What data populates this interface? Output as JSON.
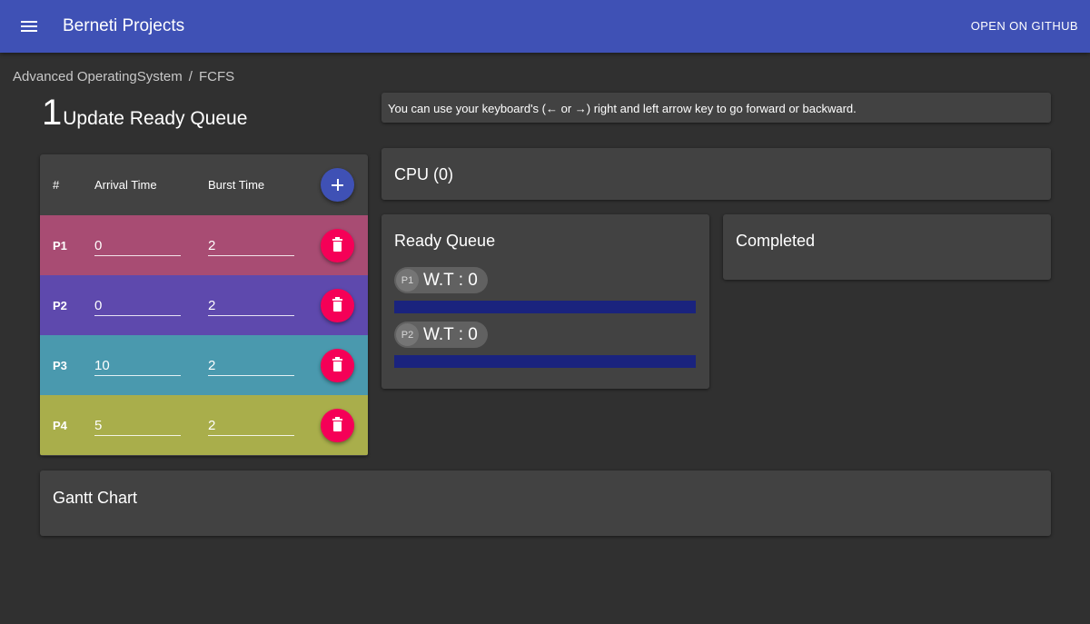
{
  "appbar": {
    "title": "Berneti Projects",
    "github_label": "OPEN ON GITHUB",
    "icons": {
      "menu": "menu-icon"
    },
    "color": "#3f51b5"
  },
  "breadcrumb": {
    "items": [
      "Advanced OperatingSystem",
      "FCFS"
    ],
    "separator": "/"
  },
  "step": {
    "number": "1",
    "title": "Update Ready Queue"
  },
  "hint": "You can use your keyboard's (← or →) right and left arrow key to go forward or backward.",
  "process_table": {
    "headers": {
      "id": "#",
      "arrival": "Arrival Time",
      "burst": "Burst Time"
    },
    "add_icon": "plus-icon",
    "delete_icon": "trash-icon",
    "rows": [
      {
        "name": "P1",
        "arrival": "0",
        "burst": "2",
        "color": "#a84c73"
      },
      {
        "name": "P2",
        "arrival": "0",
        "burst": "2",
        "color": "#5e49ad"
      },
      {
        "name": "P3",
        "arrival": "10",
        "burst": "2",
        "color": "#4a99ae"
      },
      {
        "name": "P4",
        "arrival": "5",
        "burst": "2",
        "color": "#a9ae4b"
      }
    ]
  },
  "cpu": {
    "title": "CPU (0)"
  },
  "ready_queue": {
    "title": "Ready Queue",
    "items": [
      {
        "avatar": "P1",
        "label": "W.T : 0"
      },
      {
        "avatar": "P2",
        "label": "W.T : 0"
      }
    ]
  },
  "completed": {
    "title": "Completed"
  },
  "gantt": {
    "title": "Gantt Chart"
  },
  "colors": {
    "background": "#303030",
    "card": "#424242",
    "accent": "#3f51b5",
    "delete": "#f50057",
    "wait_bar": "#1a237e"
  }
}
